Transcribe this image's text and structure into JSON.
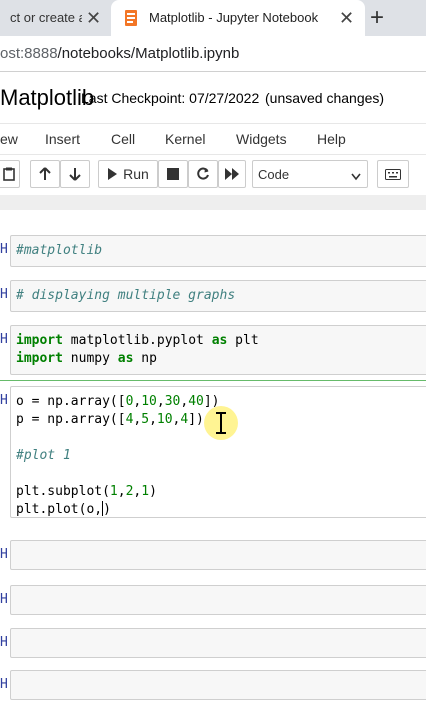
{
  "browser": {
    "tabs": [
      {
        "title": "ct or create a n",
        "state": "inactive"
      },
      {
        "title": "Matplotlib - Jupyter Notebook",
        "state": "active"
      }
    ],
    "url_host": "ost:8888",
    "url_path": "/notebooks/Matplotlib.ipynb",
    "icons": [
      "close-icon",
      "jupyter-favicon",
      "new-tab-icon"
    ]
  },
  "header": {
    "notebook_name": "Matplotlib",
    "checkpoint": "Last Checkpoint: 07/27/2022",
    "unsaved": "(unsaved changes)"
  },
  "menubar": {
    "items": [
      "ew",
      "Insert",
      "Cell",
      "Kernel",
      "Widgets",
      "Help"
    ]
  },
  "toolbar": {
    "run_label": "Run",
    "cell_type": "Code",
    "icons": [
      "paste-icon",
      "move-up-icon",
      "move-down-icon",
      "run-icon",
      "stop-icon",
      "restart-icon",
      "fast-forward-icon",
      "keyboard-icon"
    ]
  },
  "cells": [
    {
      "prompt": "H",
      "lines": [
        "#matplotlib"
      ]
    },
    {
      "prompt": "H",
      "lines": [
        "# displaying multiple graphs"
      ]
    },
    {
      "prompt": "H",
      "lines": [
        "import matplotlib.pyplot as plt",
        "import numpy as np"
      ]
    },
    {
      "prompt": "H",
      "lines": [
        "o = np.array([0,10,30,40])",
        "p = np.array([4,5,10,4])",
        "",
        "#plot 1",
        "",
        "plt.subplot(1,2,1)",
        "plt.plot(o,)"
      ]
    },
    {
      "prompt": "H",
      "lines": [
        ""
      ]
    },
    {
      "prompt": "H",
      "lines": [
        ""
      ]
    },
    {
      "prompt": "H",
      "lines": [
        ""
      ]
    },
    {
      "prompt": "H",
      "lines": [
        ""
      ]
    }
  ],
  "colors": {
    "comment": "#408080",
    "keyword": "#008000",
    "number": "#008000",
    "prompt": "#303f9f",
    "cursor_highlight": "#ffeb3b"
  }
}
